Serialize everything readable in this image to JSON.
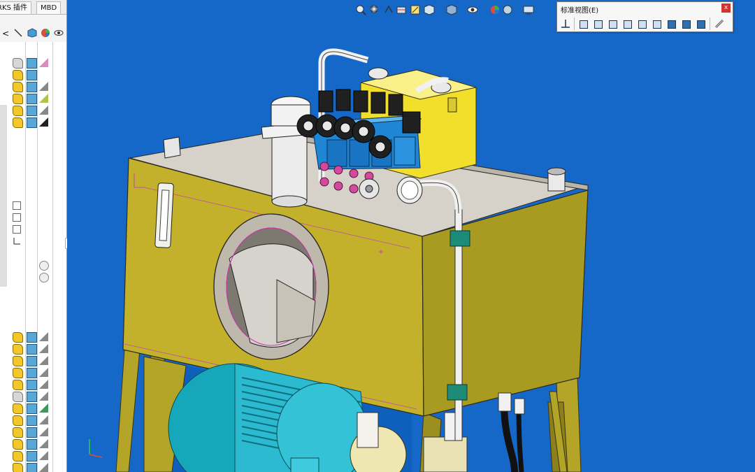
{
  "tabs": {
    "addins": "RKS 插件",
    "mbd": "MBD"
  },
  "tree_toolbar": {
    "collapse": "<"
  },
  "views_popup": {
    "title": "标准视图(E)",
    "close": "x"
  },
  "colors": {
    "viewport_bg": "#1668c8",
    "tank": "#c3b12c",
    "motor": "#36b7c9",
    "valve_block": "#f2df2c",
    "valves": "#1f86d6"
  },
  "icons": {
    "hud": [
      "zoom-to-fit-icon",
      "zoom-area-icon",
      "previous-view-icon",
      "section-view-icon",
      "dynamic-annotation-icon",
      "view-orientation-icon",
      "display-style-icon",
      "hide-show-icon",
      "appearance-icon",
      "scene-icon",
      "view-settings-icon"
    ],
    "views": [
      "normal-to-icon",
      "front-view-icon",
      "back-view-icon",
      "left-view-icon",
      "right-view-icon",
      "top-view-icon",
      "bottom-view-icon",
      "isometric-icon",
      "trimetric-icon",
      "dimetric-icon",
      "link-view-icon"
    ]
  }
}
